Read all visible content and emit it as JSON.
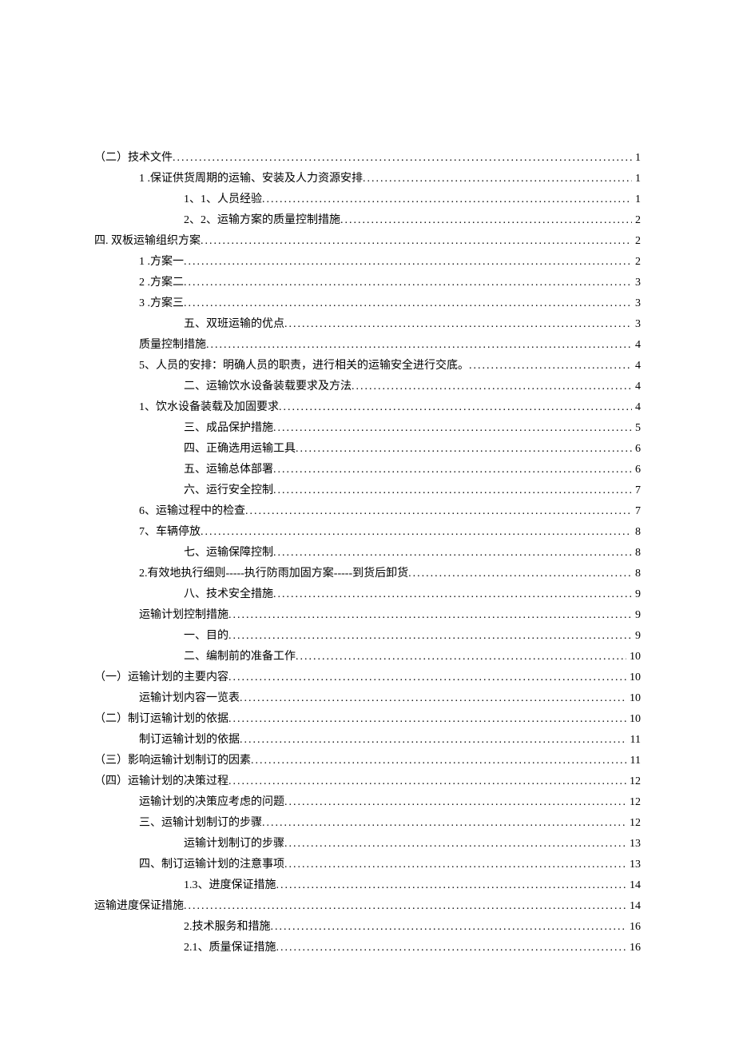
{
  "toc": [
    {
      "text": "（二）技术文件",
      "page": "1",
      "indent": 0
    },
    {
      "text": "1 .保证供货周期的运输、安装及人力资源安排",
      "page": "1",
      "indent": 1
    },
    {
      "text": "1、1、人员经验",
      "page": "1",
      "indent": 2
    },
    {
      "text": "2、2、运输方案的质量控制措施",
      "page": "2",
      "indent": 2
    },
    {
      "text": "四. 双板运输组织方案",
      "page": "2",
      "indent": 0
    },
    {
      "text": "1 .方案一",
      "page": "2",
      "indent": 1
    },
    {
      "text": "2 .方案二",
      "page": "3",
      "indent": 1
    },
    {
      "text": "3 .方案三",
      "page": "3",
      "indent": 1
    },
    {
      "text": "五、双班运输的优点",
      "page": "3",
      "indent": 2
    },
    {
      "text": "质量控制措施",
      "page": "4",
      "indent": 1
    },
    {
      "text": "5、人员的安排：明确人员的职责，进行相关的运输安全进行交底。",
      "page": "4",
      "indent": 1
    },
    {
      "text": "二、运输饮水设备装载要求及方法",
      "page": "4",
      "indent": 2
    },
    {
      "text": "1、饮水设备装载及加固要求",
      "page": "4",
      "indent": 1
    },
    {
      "text": "三、成品保护措施",
      "page": "5",
      "indent": 2
    },
    {
      "text": "四、正确选用运输工具",
      "page": "6",
      "indent": 2
    },
    {
      "text": "五、运输总体部署",
      "page": "6",
      "indent": 2
    },
    {
      "text": "六、运行安全控制",
      "page": "7",
      "indent": 2
    },
    {
      "text": "6、运输过程中的检查",
      "page": "7",
      "indent": 1
    },
    {
      "text": "7、车辆停放",
      "page": "8",
      "indent": 1
    },
    {
      "text": "七、运输保障控制",
      "page": "8",
      "indent": 2
    },
    {
      "text": "2.有效地执行细则-----执行防雨加固方案-----到货后卸货",
      "page": "8",
      "indent": 1
    },
    {
      "text": "八、技术安全措施",
      "page": "9",
      "indent": 2
    },
    {
      "text": "运输计划控制措施",
      "page": "9",
      "indent": 1
    },
    {
      "text": "一、目的",
      "page": "9",
      "indent": 2
    },
    {
      "text": "二、编制前的准备工作",
      "page": "10",
      "indent": 2
    },
    {
      "text": "（一）运输计划的主要内容",
      "page": "10",
      "indent": 0
    },
    {
      "text": "运输计划内容一览表",
      "page": "10",
      "indent": 1
    },
    {
      "text": "（二）制订运输计划的依据",
      "page": "10",
      "indent": 0
    },
    {
      "text": "制订运输计划的依据",
      "page": "11",
      "indent": 1
    },
    {
      "text": "（三）影响运输计划制订的因素",
      "page": "11",
      "indent": 0
    },
    {
      "text": "（四）运输计划的决策过程",
      "page": "12",
      "indent": 0
    },
    {
      "text": "运输计划的决策应考虑的问题",
      "page": "12",
      "indent": 1
    },
    {
      "text": "三、运输计划制订的步骤",
      "page": "12",
      "indent": 1
    },
    {
      "text": "运输计划制订的步骤",
      "page": "13",
      "indent": 2
    },
    {
      "text": "四、制订运输计划的注意事项",
      "page": "13",
      "indent": 1
    },
    {
      "text": "1.3、进度保证措施",
      "page": "14",
      "indent": 2
    },
    {
      "text": "运输进度保证措施",
      "page": "14",
      "indent": 0
    },
    {
      "text": "2.技术服务和措施",
      "page": "16",
      "indent": 2
    },
    {
      "text": "2.1、质量保证措施",
      "page": "16",
      "indent": 2
    }
  ]
}
